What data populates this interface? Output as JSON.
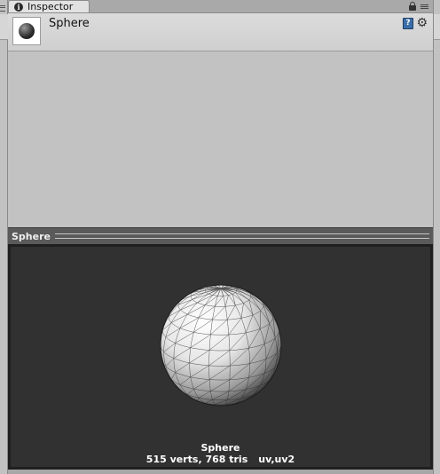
{
  "window": {
    "tab_label": "Inspector",
    "tab_icon": "info-icon"
  },
  "header": {
    "title": "Sphere",
    "thumbnail_icon": "sphere-thumbnail"
  },
  "preview": {
    "title": "Sphere",
    "mesh_name": "Sphere",
    "verts_tris": "515 verts, 768 tris",
    "uv_channels": "uv,uv2"
  },
  "colors": {
    "preview_bg": "#313131",
    "panel_bg": "#c2c2c2",
    "help_icon": "#3b6ea8"
  }
}
